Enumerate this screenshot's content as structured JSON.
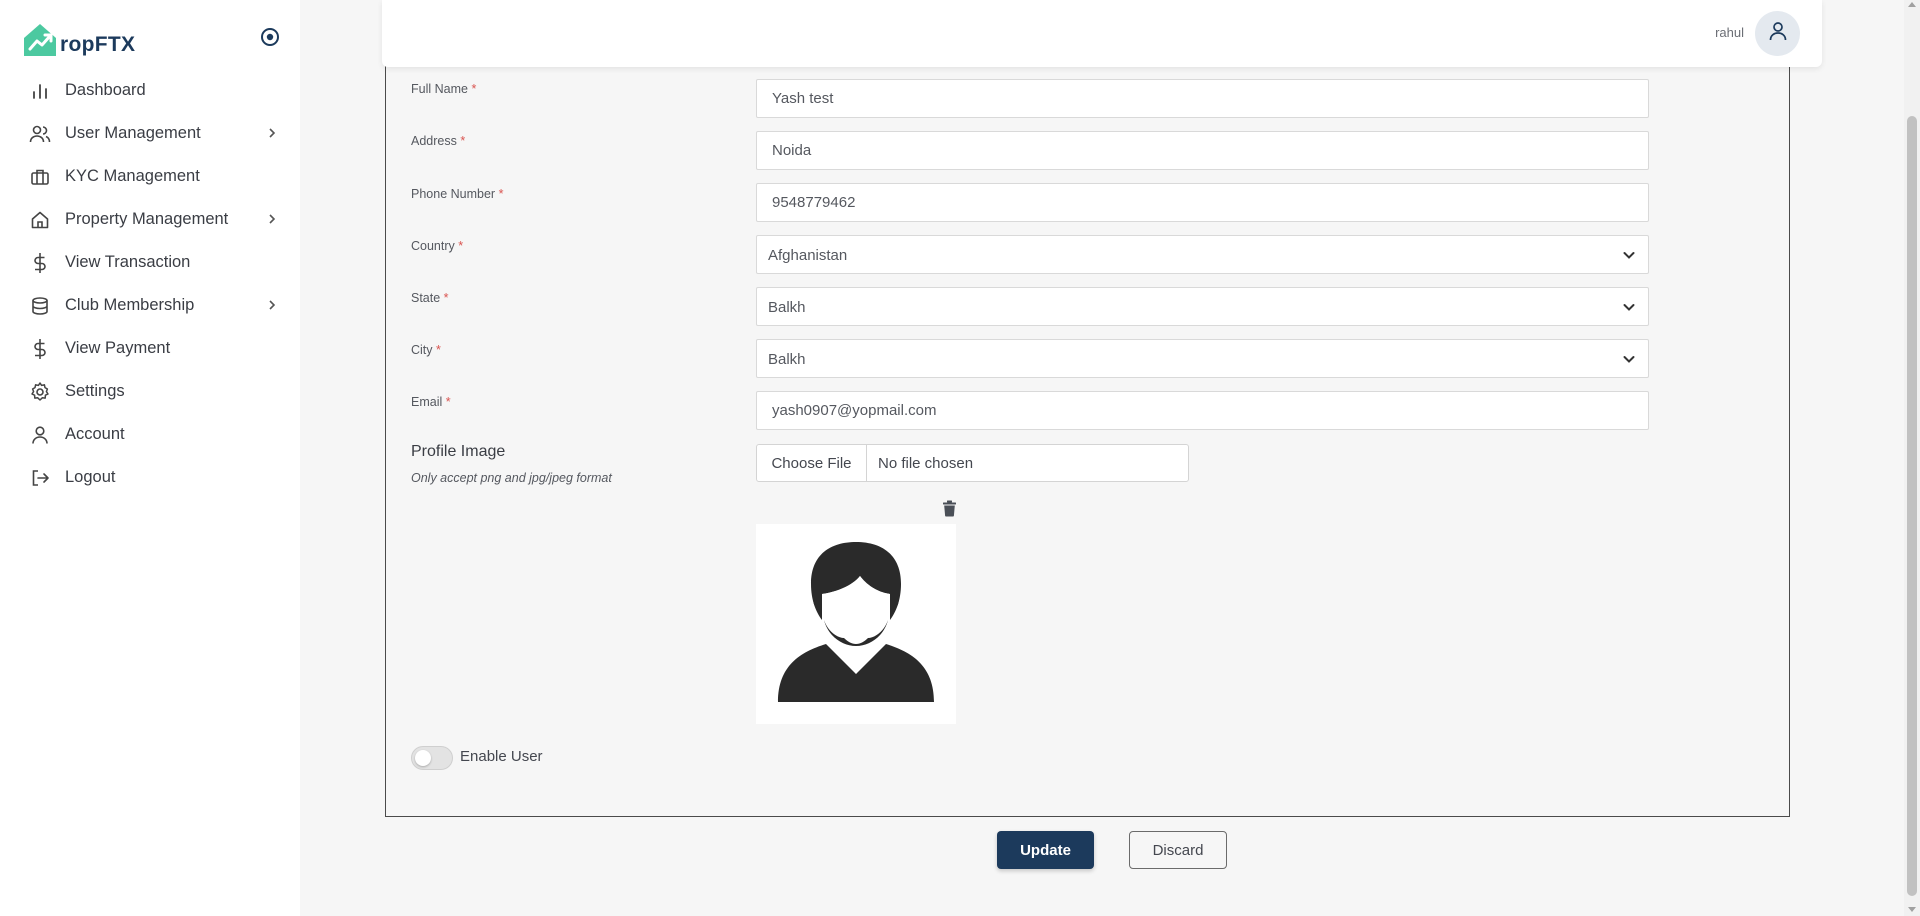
{
  "app": {
    "logo_text": "ropFTX",
    "brand_color": "#1c3a5c",
    "logo_color": "#4cc9a0"
  },
  "sidebar": {
    "items": [
      {
        "label": "Dashboard",
        "icon": "bar-chart-icon"
      },
      {
        "label": "User Management",
        "icon": "users-icon",
        "expandable": true
      },
      {
        "label": "KYC Management",
        "icon": "briefcase-icon"
      },
      {
        "label": "Property Management",
        "icon": "home-icon",
        "expandable": true
      },
      {
        "label": "View Transaction",
        "icon": "dollar-icon"
      },
      {
        "label": "Club Membership",
        "icon": "database-icon",
        "expandable": true
      },
      {
        "label": "View Payment",
        "icon": "dollar-icon"
      },
      {
        "label": "Settings",
        "icon": "gear-icon"
      },
      {
        "label": "Account",
        "icon": "user-icon"
      },
      {
        "label": "Logout",
        "icon": "logout-icon"
      }
    ]
  },
  "header": {
    "user_name": "rahul"
  },
  "form": {
    "full_name": {
      "label": "Full Name",
      "required": "*",
      "value": "Yash test"
    },
    "address": {
      "label": "Address",
      "required": "*",
      "value": "Noida"
    },
    "phone": {
      "label": "Phone Number",
      "required": "*",
      "value": "9548779462"
    },
    "country": {
      "label": "Country",
      "required": "*",
      "value": "Afghanistan"
    },
    "state": {
      "label": "State",
      "required": "*",
      "value": "Balkh"
    },
    "city": {
      "label": "City",
      "required": "*",
      "value": "Balkh"
    },
    "email": {
      "label": "Email",
      "required": "*",
      "value": "yash0907@yopmail.com"
    },
    "profile_image": {
      "title": "Profile Image",
      "hint": "Only accept png and jpg/jpeg format",
      "choose_label": "Choose File",
      "file_status": "No file chosen"
    },
    "enable_user": {
      "label": "Enable User",
      "enabled": false
    }
  },
  "actions": {
    "update_label": "Update",
    "discard_label": "Discard"
  }
}
